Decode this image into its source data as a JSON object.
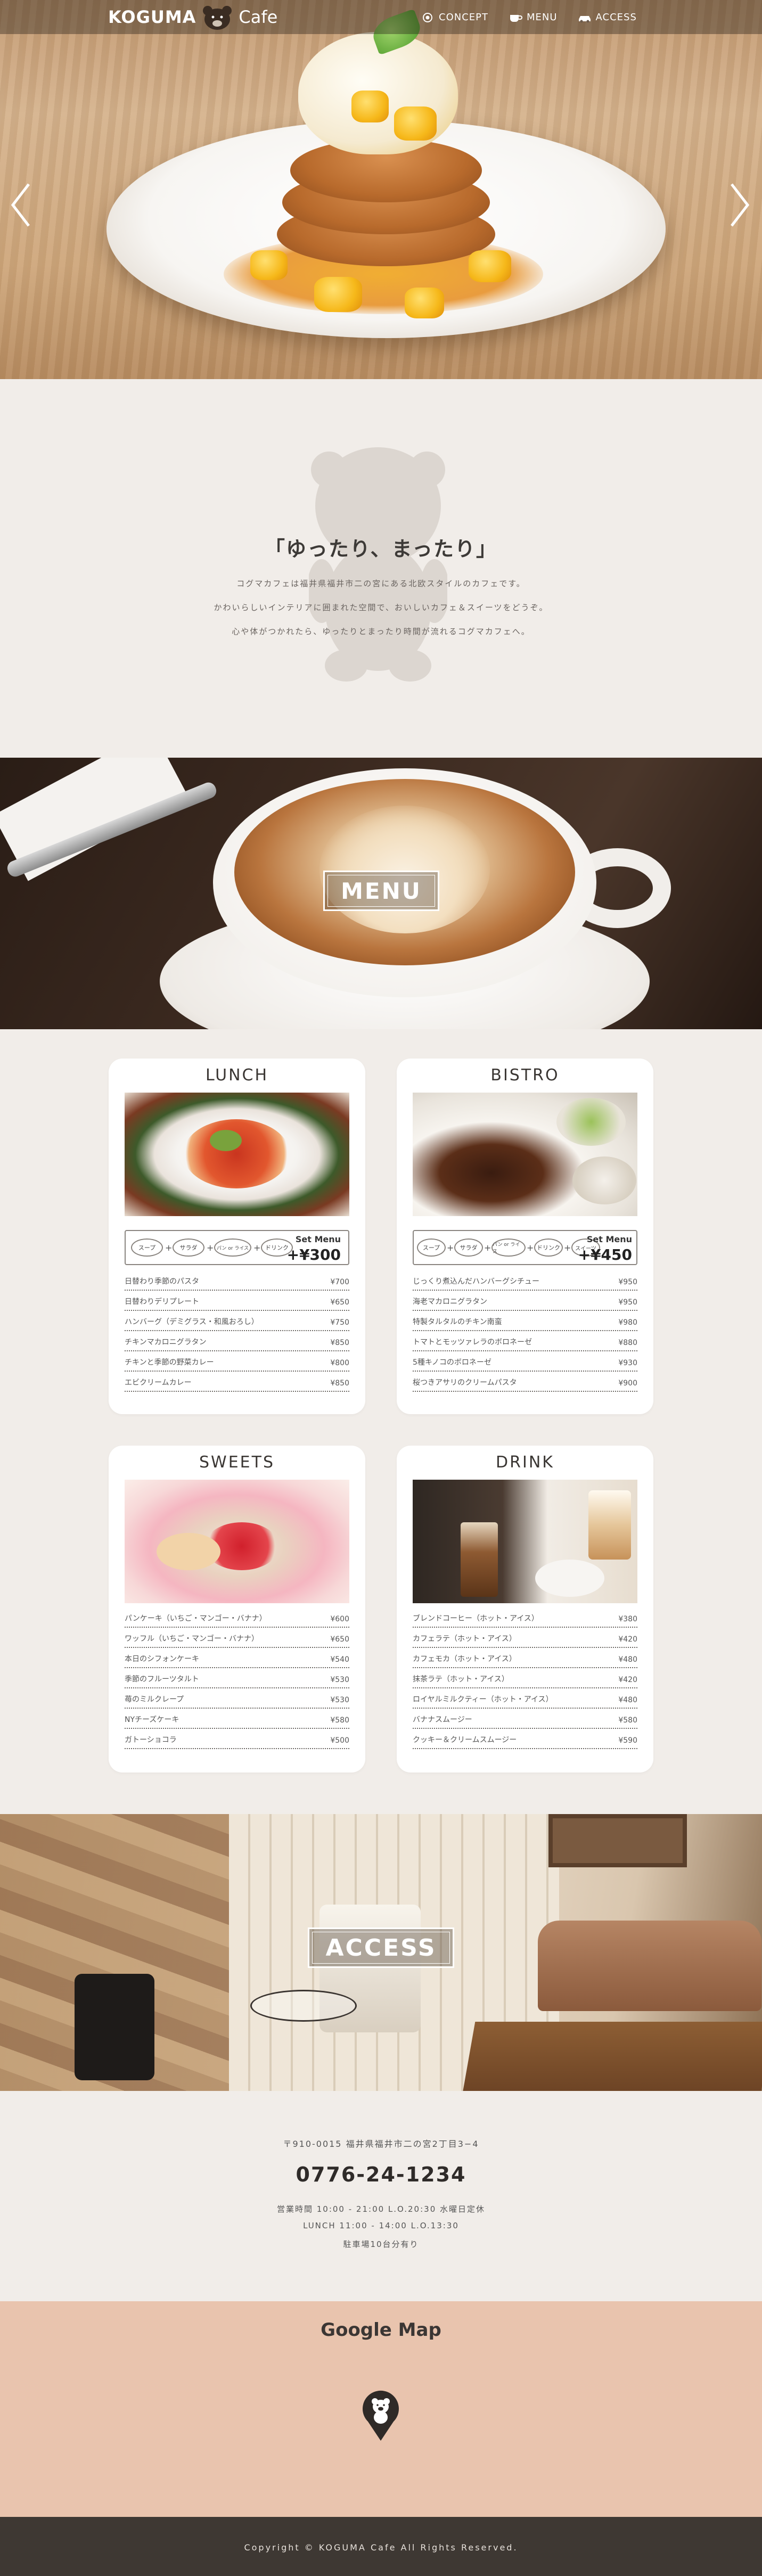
{
  "header": {
    "logo_main": "KOGUMA",
    "logo_sub": "Cafe",
    "nav": [
      {
        "label": "CONCEPT",
        "icon": "emblem-icon"
      },
      {
        "label": "MENU",
        "icon": "coffee-cup-icon"
      },
      {
        "label": "ACCESS",
        "icon": "car-icon"
      }
    ]
  },
  "concept": {
    "title": "「ゆったり、まったり」",
    "lines": [
      "コグマカフェは福井県福井市二の宮にある北欧スタイルのカフェです。",
      "かわいらしいインテリアに囲まれた空間で、おいしいカフェ＆スイーツをどうぞ。",
      "心や体がつかれたら、ゆったりとまったり時間が流れるコグマカフェへ。"
    ]
  },
  "menu_banner": {
    "label": "MENU"
  },
  "set_menu_items": [
    "スープ",
    "サラダ",
    "パン or ライス",
    "ドリンク",
    "スイーツ"
  ],
  "cards": {
    "lunch": {
      "title": "LUNCH",
      "set_label": "Set Menu",
      "set_price": "+¥300",
      "set_items": [
        "スープ",
        "サラダ",
        "パン or ライス",
        "ドリンク"
      ],
      "items": [
        {
          "name": "日替わり季節のパスタ",
          "price": "¥700"
        },
        {
          "name": "日替わりデリプレート",
          "price": "¥650"
        },
        {
          "name": "ハンバーグ（デミグラス・和風おろし）",
          "price": "¥750"
        },
        {
          "name": "チキンマカロニグラタン",
          "price": "¥850"
        },
        {
          "name": "チキンと季節の野菜カレー",
          "price": "¥800"
        },
        {
          "name": "エビクリームカレー",
          "price": "¥850"
        }
      ]
    },
    "bistro": {
      "title": "BISTRO",
      "set_label": "Set Menu",
      "set_price": "+¥450",
      "set_items": [
        "スープ",
        "サラダ",
        "パン or ライス",
        "ドリンク",
        "スイーツ"
      ],
      "items": [
        {
          "name": "じっくり煮込んだハンバーグシチュー",
          "price": "¥950"
        },
        {
          "name": "海老マカロニグラタン",
          "price": "¥950"
        },
        {
          "name": "特製タルタルのチキン南蛮",
          "price": "¥980"
        },
        {
          "name": "トマトとモッツァレラのボロネーゼ",
          "price": "¥880"
        },
        {
          "name": "5種キノコのボロネーゼ",
          "price": "¥930"
        },
        {
          "name": "桜つきアサリのクリームパスタ",
          "price": "¥900"
        }
      ]
    },
    "sweets": {
      "title": "SWEETS",
      "items": [
        {
          "name": "パンケーキ（いちご・マンゴー・バナナ）",
          "price": "¥600"
        },
        {
          "name": "ワッフル（いちご・マンゴー・バナナ）",
          "price": "¥650"
        },
        {
          "name": "本日のシフォンケーキ",
          "price": "¥540"
        },
        {
          "name": "季節のフルーツタルト",
          "price": "¥530"
        },
        {
          "name": "苺のミルクレープ",
          "price": "¥530"
        },
        {
          "name": "NYチーズケーキ",
          "price": "¥580"
        },
        {
          "name": "ガトーショコラ",
          "price": "¥500"
        }
      ]
    },
    "drink": {
      "title": "DRINK",
      "items": [
        {
          "name": "ブレンドコーヒー（ホット・アイス）",
          "price": "¥380"
        },
        {
          "name": "カフェラテ（ホット・アイス）",
          "price": "¥420"
        },
        {
          "name": "カフェモカ（ホット・アイス）",
          "price": "¥480"
        },
        {
          "name": "抹茶ラテ（ホット・アイス）",
          "price": "¥420"
        },
        {
          "name": "ロイヤルミルクティー（ホット・アイス）",
          "price": "¥480"
        },
        {
          "name": "バナナスムージー",
          "price": "¥580"
        },
        {
          "name": "クッキー＆クリームスムージー",
          "price": "¥590"
        }
      ]
    }
  },
  "access_banner": {
    "label": "ACCESS"
  },
  "info": {
    "address": "〒910-0015 福井県福井市二の宮2丁目3−4",
    "phone": "0776-24-1234",
    "hours": "営業時間 10:00 - 21:00  L.O.20:30 水曜日定休",
    "lunch": "LUNCH 11:00 - 14:00  L.O.13:30",
    "parking": "駐車場10台分有り"
  },
  "map": {
    "title": "Google Map"
  },
  "footer": {
    "copyright": "Copyright © KOGUMA Cafe All Rights Reserved."
  },
  "colors": {
    "background": "#f1ede9",
    "map_bg": "#e9c4ae",
    "footer_bg": "#3e3833",
    "text_dark": "#3a3633"
  }
}
